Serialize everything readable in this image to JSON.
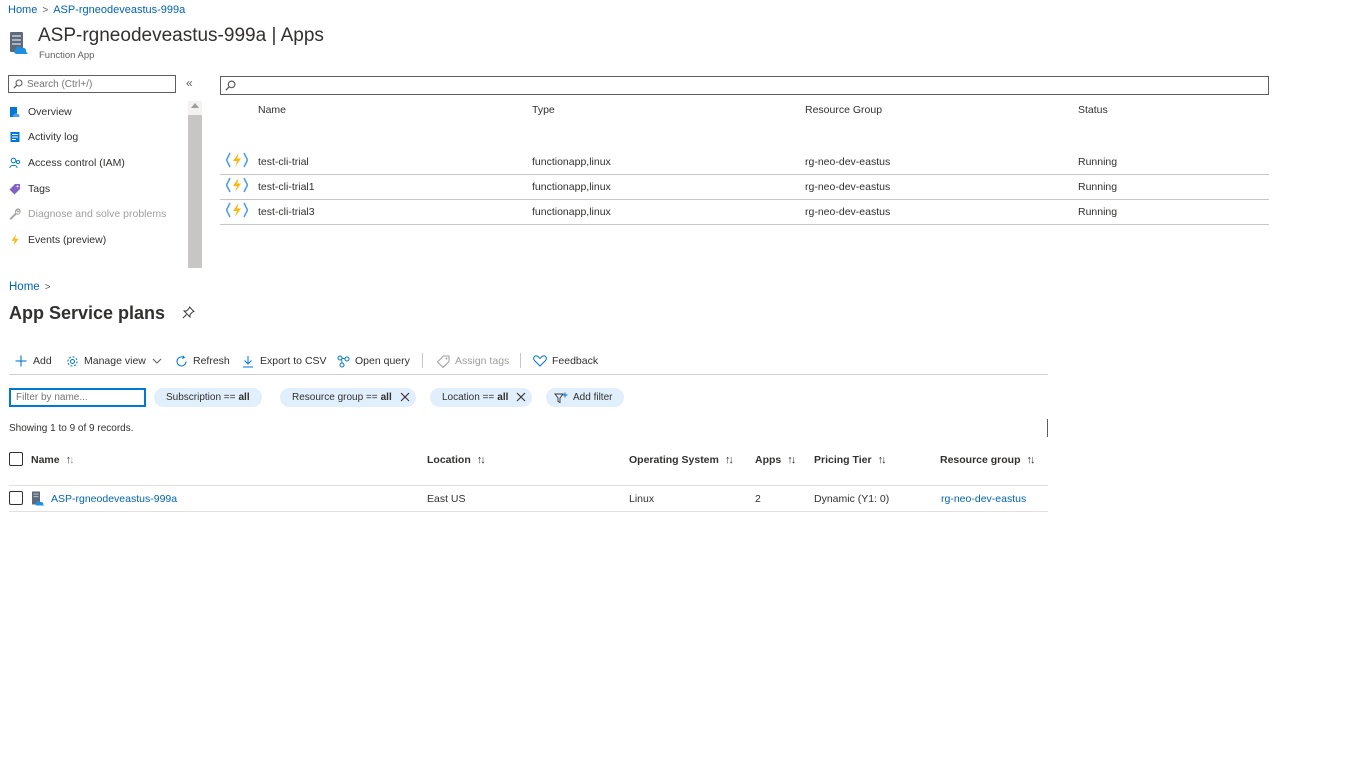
{
  "breadcrumb_top": {
    "home": "Home",
    "current": "ASP-rgneodeveastus-999a"
  },
  "resource": {
    "title": "ASP-rgneodeveastus-999a",
    "section": "Apps",
    "separator": "|",
    "subtitle": "Function App",
    "icon": "app-service-plan-icon"
  },
  "sidebar": {
    "search_placeholder": "Search (Ctrl+/)",
    "collapse_glyph": "«",
    "items": [
      {
        "label": "Overview",
        "icon": "overview-icon",
        "color": "#0078d4"
      },
      {
        "label": "Activity log",
        "icon": "activity-log-icon",
        "color": "#0078d4"
      },
      {
        "label": "Access control (IAM)",
        "icon": "iam-icon",
        "color": "#0078d4"
      },
      {
        "label": "Tags",
        "icon": "tag-icon",
        "color": "#8661c5"
      },
      {
        "label": "Diagnose and solve problems",
        "icon": "wrench-icon",
        "color": "#a19f9d",
        "disabled": true
      },
      {
        "label": "Events (preview)",
        "icon": "lightning-icon",
        "color": "#f8b912"
      }
    ]
  },
  "apps_table": {
    "filter_value": "",
    "columns": [
      "Name",
      "Type",
      "Resource Group",
      "Status"
    ],
    "rows": [
      {
        "name": "test-cli-trial",
        "type": "functionapp,linux",
        "resource_group": "rg-neo-dev-eastus",
        "status": "Running"
      },
      {
        "name": "test-cli-trial1",
        "type": "functionapp,linux",
        "resource_group": "rg-neo-dev-eastus",
        "status": "Running"
      },
      {
        "name": "test-cli-trial3",
        "type": "functionapp,linux",
        "resource_group": "rg-neo-dev-eastus",
        "status": "Running"
      }
    ]
  },
  "breadcrumb_bottom": {
    "home": "Home"
  },
  "asp_page": {
    "title": "App Service plans",
    "pin_icon": "pin-icon",
    "toolbar": {
      "add": "Add",
      "manage_view": "Manage view",
      "refresh": "Refresh",
      "export_csv": "Export to CSV",
      "open_query": "Open query",
      "assign_tags": "Assign tags",
      "feedback": "Feedback"
    },
    "filter_placeholder": "Filter by name...",
    "pills": [
      {
        "label": "Subscription ==",
        "value": "all",
        "removable": false
      },
      {
        "label": "Resource group ==",
        "value": "all",
        "removable": true
      },
      {
        "label": "Location ==",
        "value": "all",
        "removable": true
      }
    ],
    "add_filter": "Add filter",
    "records": "Showing 1 to 9 of 9 records.",
    "columns": [
      "Name",
      "Location",
      "Operating System",
      "Apps",
      "Pricing Tier",
      "Resource group"
    ],
    "rows": [
      {
        "name": "ASP-rgneodeveastus-999a",
        "location": "East US",
        "os": "Linux",
        "apps": "2",
        "pricing_tier": "Dynamic (Y1: 0)",
        "resource_group": "rg-neo-dev-eastus"
      }
    ]
  },
  "colors": {
    "link": "#0064b4",
    "accent": "#0078d4",
    "pill_bg": "#e1eefb",
    "function_yellow": "#f8b912"
  }
}
